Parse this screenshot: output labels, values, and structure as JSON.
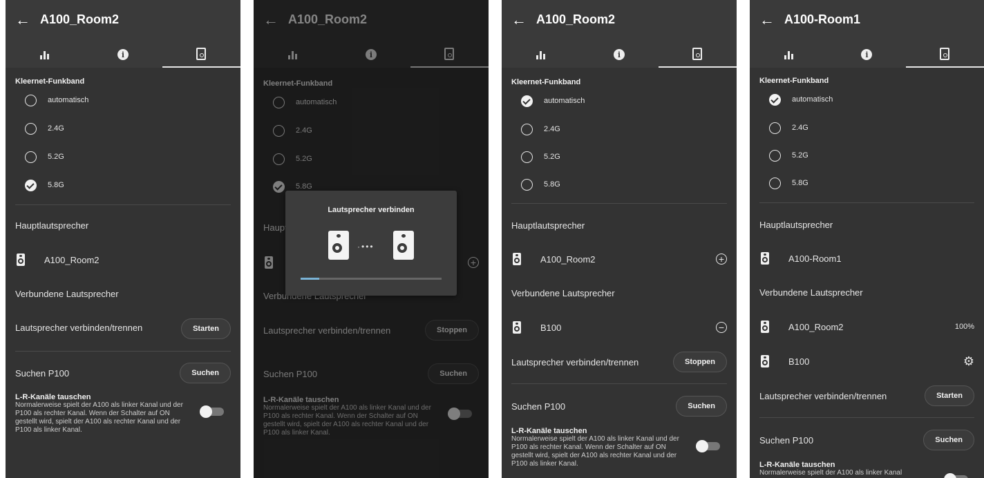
{
  "screens": [
    {
      "title": "A100_Room2",
      "back_icon": "←",
      "band_label": "Kleernet-Funkband",
      "bands": [
        "automatisch",
        "2.4G",
        "5.2G",
        "5.8G"
      ],
      "selected_band": "5.8G",
      "main_heading": "Hauptlautsprecher",
      "main_speaker": "A100_Room2",
      "connected_heading": "Verbundene Lautsprecher",
      "connect_label": "Lautsprecher verbinden/trennen",
      "connect_button": "Starten",
      "search_label": "Suchen P100",
      "search_button": "Suchen",
      "swap_title": "L-R-Kanäle tauschen",
      "swap_desc": "Normalerweise spielt der A100 als linker Kanal und der P100 als rechter Kanal. Wenn der Schalter auf ON gestellt wird, spielt der A100 als rechter Kanal und der P100 als linker Kanal."
    },
    {
      "title": "A100_Room2",
      "back_icon": "←",
      "band_label": "Kleernet-Funkband",
      "bands": [
        "automatisch",
        "2.4G",
        "5.2G",
        "5.8G"
      ],
      "selected_band": "5.8G",
      "main_heading": "Hauptlautsprecher",
      "connected_heading": "Verbundene Lautsprecher",
      "connect_label": "Lautsprecher verbinden/trennen",
      "connect_button": "Stoppen",
      "search_label": "Suchen P100",
      "search_button": "Suchen",
      "swap_title": "L-R-Kanäle tauschen",
      "swap_desc": "Normalerweise spielt der A100 als linker Kanal und der P100 als rechter Kanal. Wenn der Schalter auf ON gestellt wird, spielt der A100 als rechter Kanal und der P100 als linker Kanal.",
      "dialog_title": "Lautsprecher verbinden",
      "dialog_progress": 0.13
    },
    {
      "title": "A100_Room2",
      "back_icon": "←",
      "band_label": "Kleernet-Funkband",
      "bands": [
        "automatisch",
        "2.4G",
        "5.2G",
        "5.8G"
      ],
      "selected_band": "automatisch",
      "main_heading": "Hauptlautsprecher",
      "main_speaker": "A100_Room2",
      "connected_heading": "Verbundene Lautsprecher",
      "connected_speaker": "B100",
      "connect_label": "Lautsprecher verbinden/trennen",
      "connect_button": "Stoppen",
      "search_label": "Suchen P100",
      "search_button": "Suchen",
      "swap_title": "L-R-Kanäle tauschen",
      "swap_desc": "Normalerweise spielt der A100 als linker Kanal und der P100 als rechter Kanal. Wenn der Schalter auf ON gestellt wird, spielt der A100 als rechter Kanal und der P100 als linker Kanal."
    },
    {
      "title": "A100-Room1",
      "back_icon": "←",
      "band_label": "Kleernet-Funkband",
      "bands": [
        "automatisch",
        "2.4G",
        "5.2G",
        "5.8G"
      ],
      "selected_band": "automatisch",
      "main_heading": "Hauptlautsprecher",
      "main_speaker": "A100-Room1",
      "connected_heading": "Verbundene Lautsprecher",
      "connected_speakers": [
        "A100_Room2",
        "B100"
      ],
      "connected_status": "100%",
      "connect_label": "Lautsprecher verbinden/trennen",
      "connect_button": "Starten",
      "search_label": "Suchen P100",
      "search_button": "Suchen",
      "swap_title": "L-R-Kanäle tauschen",
      "swap_desc": "Normalerweise spielt der A100 als linker Kanal"
    }
  ],
  "icons": {
    "tab_stats": "bar-chart-icon",
    "tab_info": "info-icon",
    "tab_speaker": "speaker-icon",
    "gear": "gear-icon"
  },
  "colors": {
    "background": "#333333",
    "appbar": "#3a3a3a",
    "text": "#e6e6e6",
    "progress": "#7ab3d6"
  }
}
